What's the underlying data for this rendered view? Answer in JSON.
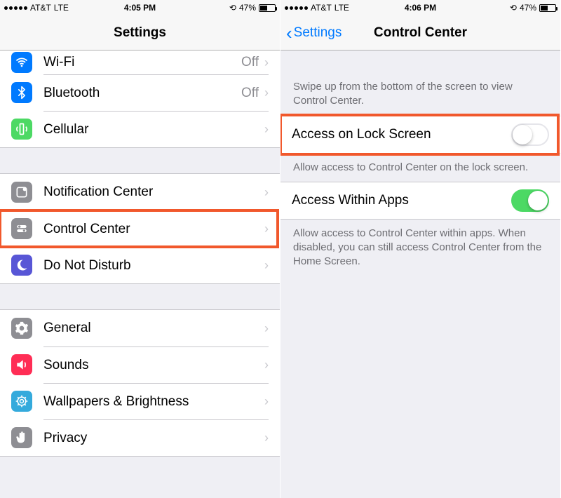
{
  "left": {
    "status": {
      "carrier": "AT&T",
      "net": "LTE",
      "time": "4:05 PM",
      "battery_pct": "47%"
    },
    "nav_title": "Settings",
    "rows": {
      "wifi": {
        "label": "Wi-Fi",
        "value": "Off"
      },
      "bluetooth": {
        "label": "Bluetooth",
        "value": "Off"
      },
      "cellular": {
        "label": "Cellular",
        "value": ""
      },
      "notif": {
        "label": "Notification Center",
        "value": ""
      },
      "cc": {
        "label": "Control Center",
        "value": ""
      },
      "dnd": {
        "label": "Do Not Disturb",
        "value": ""
      },
      "general": {
        "label": "General",
        "value": ""
      },
      "sounds": {
        "label": "Sounds",
        "value": ""
      },
      "wallpaper": {
        "label": "Wallpapers & Brightness",
        "value": ""
      },
      "privacy": {
        "label": "Privacy",
        "value": ""
      }
    },
    "icon_colors": {
      "wifi": "#007aff",
      "bluetooth": "#007aff",
      "cellular": "#4cd964",
      "notif": "#8e8e93",
      "cc": "#8e8e93",
      "dnd": "#5856d6",
      "general": "#8e8e93",
      "sounds": "#ff2d55",
      "wallpaper": "#34aadc",
      "privacy": "#8e8e93"
    }
  },
  "right": {
    "status": {
      "carrier": "AT&T",
      "net": "LTE",
      "time": "4:06 PM",
      "battery_pct": "47%"
    },
    "nav_back": "Settings",
    "nav_title": "Control Center",
    "intro": "Swipe up from the bottom of the screen to view Control Center.",
    "rows": {
      "lock": {
        "label": "Access on Lock Screen",
        "on": false
      },
      "apps": {
        "label": "Access Within Apps",
        "on": true
      }
    },
    "lock_footer": "Allow access to Control Center on the lock screen.",
    "apps_footer": "Allow access to Control Center within apps. When disabled, you can still access Control Center from the Home Screen."
  }
}
